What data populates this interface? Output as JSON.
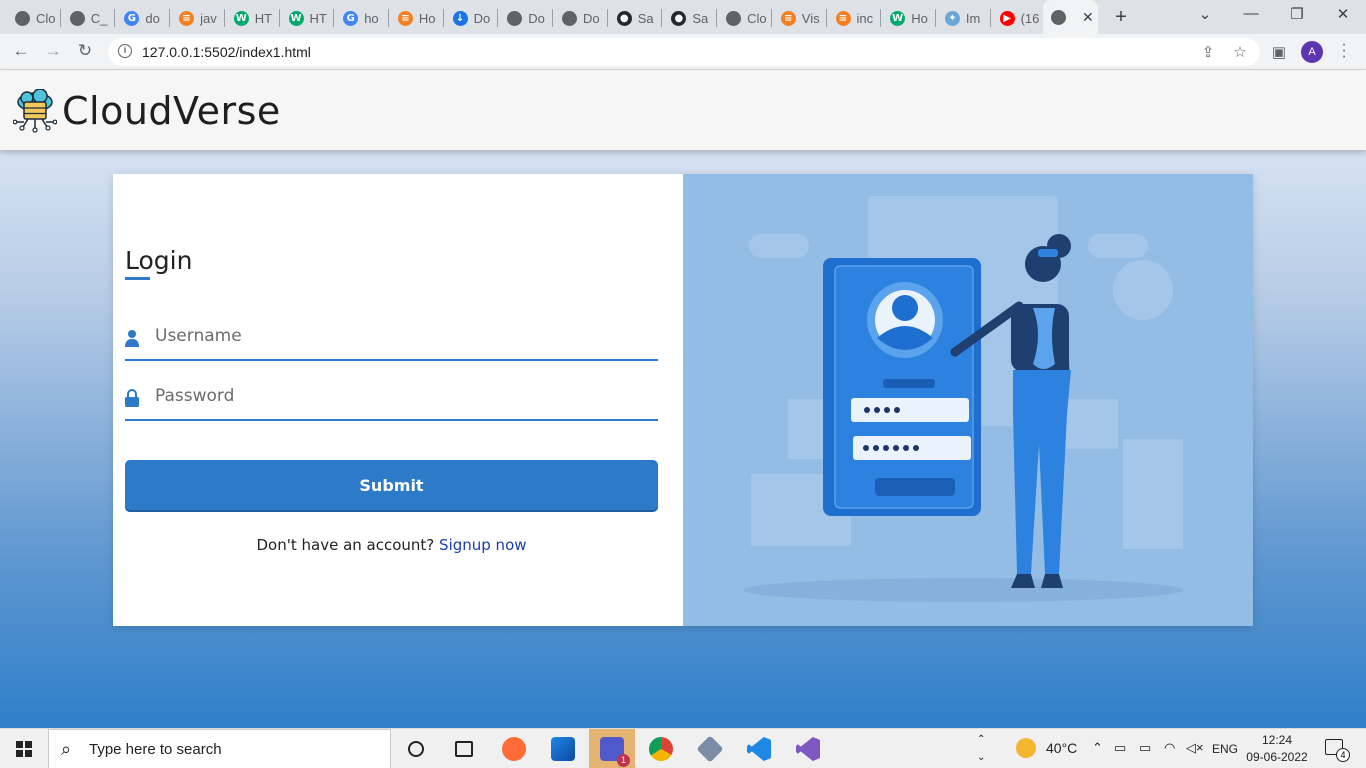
{
  "browser": {
    "tabs": [
      {
        "title": "Clo",
        "icon": "globe-icon",
        "color": "#5f6368"
      },
      {
        "title": "C_",
        "icon": "globe-icon",
        "color": "#5f6368"
      },
      {
        "title": "do",
        "icon": "google-icon",
        "color": "#4285f4"
      },
      {
        "title": "jav",
        "icon": "stackoverflow-icon",
        "color": "#f48024"
      },
      {
        "title": "HT",
        "icon": "w3schools-icon",
        "color": "#04aa6d"
      },
      {
        "title": "HT",
        "icon": "w3schools-icon",
        "color": "#04aa6d"
      },
      {
        "title": "ho",
        "icon": "google-icon",
        "color": "#4285f4"
      },
      {
        "title": "Ho",
        "icon": "stackoverflow-icon",
        "color": "#f48024"
      },
      {
        "title": "Do",
        "icon": "download-icon",
        "color": "#1a73e8"
      },
      {
        "title": "Do",
        "icon": "globe-icon",
        "color": "#5f6368"
      },
      {
        "title": "Do",
        "icon": "globe-icon",
        "color": "#5f6368"
      },
      {
        "title": "Sa",
        "icon": "github-icon",
        "color": "#24292f"
      },
      {
        "title": "Sa",
        "icon": "github-icon",
        "color": "#24292f"
      },
      {
        "title": "Clo",
        "icon": "globe-icon",
        "color": "#5f6368"
      },
      {
        "title": "Vis",
        "icon": "stackoverflow-icon",
        "color": "#f48024"
      },
      {
        "title": "inc",
        "icon": "stackoverflow-icon",
        "color": "#f48024"
      },
      {
        "title": "Ho",
        "icon": "w3schools-icon",
        "color": "#04aa6d"
      },
      {
        "title": "Im",
        "icon": "image-icon",
        "color": "#6aa6d8"
      },
      {
        "title": "(16",
        "icon": "youtube-icon",
        "color": "#ff0000"
      }
    ],
    "active_tab_icon": "globe-icon",
    "url": "127.0.0.1:5502/index1.html",
    "profile_initial": "A"
  },
  "site": {
    "brand": "CloudVerse"
  },
  "login": {
    "title": "Login",
    "username_placeholder": "Username",
    "password_placeholder": "Password",
    "submit_label": "Submit",
    "signup_prompt": "Don't have an account?",
    "signup_link": "Signup now"
  },
  "taskbar": {
    "search_placeholder": "Type here to search",
    "weather": "40°C",
    "language": "ENG",
    "time": "12:24",
    "date": "09-06-2022",
    "notification_count": "4",
    "teams_badge": "1"
  },
  "colors": {
    "accent": "#2d7ac8",
    "link": "#1a3faa",
    "illustration_bg": "#94bde6"
  }
}
